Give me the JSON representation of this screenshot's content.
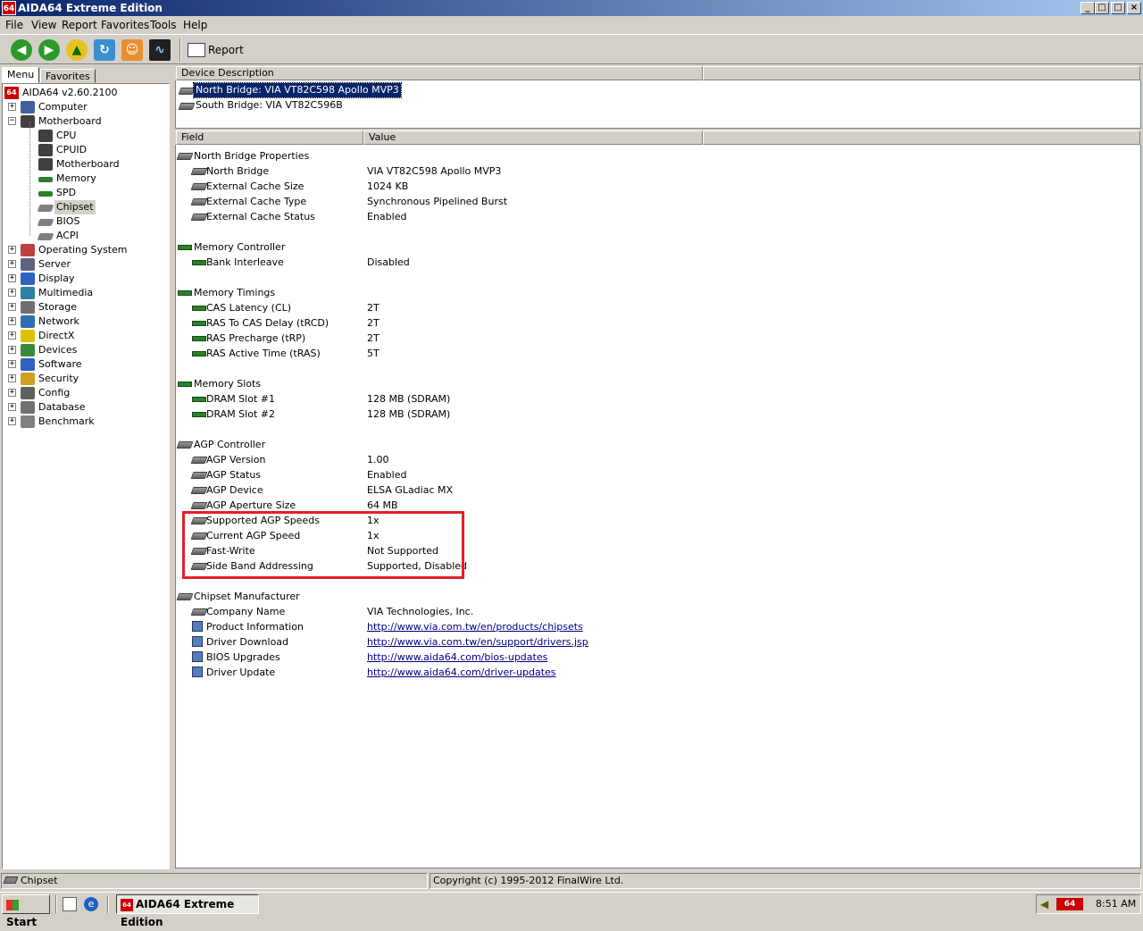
{
  "window": {
    "title": "AIDA64 Extreme Edition",
    "app_icon_text": "64",
    "controls": {
      "minimize": "_",
      "maximize": "□",
      "close": "×"
    }
  },
  "menubar": [
    "File",
    "View",
    "Report",
    "Favorites",
    "Tools",
    "Help"
  ],
  "toolbar": {
    "back_icon": "arrow-left-icon",
    "forward_icon": "arrow-right-icon",
    "up_icon": "up-icon",
    "refresh_icon": "refresh-icon",
    "users_icon": "users-icon",
    "monitor_icon": "monitor-icon",
    "report_label": "Report"
  },
  "left_tabs": [
    "Menu",
    "Favorites"
  ],
  "tree": {
    "root": "AIDA64 v2.60.2100",
    "items": [
      {
        "label": "Computer",
        "level": 1,
        "expander": "+"
      },
      {
        "label": "Motherboard",
        "level": 1,
        "expander": "−"
      },
      {
        "label": "CPU",
        "level": 2
      },
      {
        "label": "CPUID",
        "level": 2
      },
      {
        "label": "Motherboard",
        "level": 2
      },
      {
        "label": "Memory",
        "level": 2
      },
      {
        "label": "SPD",
        "level": 2
      },
      {
        "label": "Chipset",
        "level": 2,
        "selected": true
      },
      {
        "label": "BIOS",
        "level": 2
      },
      {
        "label": "ACPI",
        "level": 2
      },
      {
        "label": "Operating System",
        "level": 1,
        "expander": "+"
      },
      {
        "label": "Server",
        "level": 1,
        "expander": "+"
      },
      {
        "label": "Display",
        "level": 1,
        "expander": "+"
      },
      {
        "label": "Multimedia",
        "level": 1,
        "expander": "+"
      },
      {
        "label": "Storage",
        "level": 1,
        "expander": "+"
      },
      {
        "label": "Network",
        "level": 1,
        "expander": "+"
      },
      {
        "label": "DirectX",
        "level": 1,
        "expander": "+"
      },
      {
        "label": "Devices",
        "level": 1,
        "expander": "+"
      },
      {
        "label": "Software",
        "level": 1,
        "expander": "+"
      },
      {
        "label": "Security",
        "level": 1,
        "expander": "+"
      },
      {
        "label": "Config",
        "level": 1,
        "expander": "+"
      },
      {
        "label": "Database",
        "level": 1,
        "expander": "+"
      },
      {
        "label": "Benchmark",
        "level": 1,
        "expander": "+"
      }
    ]
  },
  "device_panel": {
    "header": "Device Description",
    "items": [
      {
        "label": "North Bridge: VIA VT82C598 Apollo MVP3",
        "selected": true
      },
      {
        "label": "South Bridge: VIA VT82C596B"
      }
    ]
  },
  "field_panel": {
    "headers": [
      "Field",
      "Value"
    ],
    "groups": [
      {
        "title": "North Bridge Properties",
        "icon": "chip",
        "rows": [
          {
            "field": "North Bridge",
            "value": "VIA VT82C598 Apollo MVP3",
            "icon": "chip"
          },
          {
            "field": "External Cache Size",
            "value": "1024 KB",
            "icon": "chip"
          },
          {
            "field": "External Cache Type",
            "value": "Synchronous Pipelined Burst",
            "icon": "chip"
          },
          {
            "field": "External Cache Status",
            "value": "Enabled",
            "icon": "chip"
          }
        ]
      },
      {
        "title": "Memory Controller",
        "icon": "ram",
        "rows": [
          {
            "field": "Bank Interleave",
            "value": "Disabled",
            "icon": "ram"
          }
        ]
      },
      {
        "title": "Memory Timings",
        "icon": "ram",
        "rows": [
          {
            "field": "CAS Latency (CL)",
            "value": "2T",
            "icon": "ram"
          },
          {
            "field": "RAS To CAS Delay (tRCD)",
            "value": "2T",
            "icon": "ram"
          },
          {
            "field": "RAS Precharge (tRP)",
            "value": "2T",
            "icon": "ram"
          },
          {
            "field": "RAS Active Time (tRAS)",
            "value": "5T",
            "icon": "ram"
          }
        ]
      },
      {
        "title": "Memory Slots",
        "icon": "ram",
        "rows": [
          {
            "field": "DRAM Slot #1",
            "value": "128 MB  (SDRAM)",
            "icon": "ram"
          },
          {
            "field": "DRAM Slot #2",
            "value": "128 MB  (SDRAM)",
            "icon": "ram"
          }
        ]
      },
      {
        "title": "AGP Controller",
        "icon": "chip",
        "rows": [
          {
            "field": "AGP Version",
            "value": "1.00",
            "icon": "chip"
          },
          {
            "field": "AGP Status",
            "value": "Enabled",
            "icon": "chip"
          },
          {
            "field": "AGP Device",
            "value": "ELSA GLadiac MX",
            "icon": "chip"
          },
          {
            "field": "AGP Aperture Size",
            "value": "64 MB",
            "icon": "chip"
          },
          {
            "field": "Supported AGP Speeds",
            "value": "1x",
            "icon": "chip"
          },
          {
            "field": "Current AGP Speed",
            "value": "1x",
            "icon": "chip"
          },
          {
            "field": "Fast-Write",
            "value": "Not Supported",
            "icon": "chip"
          },
          {
            "field": "Side Band Addressing",
            "value": "Supported, Disabled",
            "icon": "chip"
          }
        ]
      },
      {
        "title": "Chipset Manufacturer",
        "icon": "chip",
        "rows": [
          {
            "field": "Company Name",
            "value": "VIA Technologies, Inc.",
            "icon": "chip"
          },
          {
            "field": "Product Information",
            "value": "http://www.via.com.tw/en/products/chipsets",
            "icon": "link",
            "link": true
          },
          {
            "field": "Driver Download",
            "value": "http://www.via.com.tw/en/support/drivers.jsp",
            "icon": "link",
            "link": true
          },
          {
            "field": "BIOS Upgrades",
            "value": "http://www.aida64.com/bios-updates",
            "icon": "link",
            "link": true
          },
          {
            "field": "Driver Update",
            "value": "http://www.aida64.com/driver-updates",
            "icon": "link",
            "link": true
          }
        ]
      }
    ]
  },
  "statusbar": {
    "left": "Chipset",
    "right": "Copyright (c) 1995-2012 FinalWire Ltd."
  },
  "taskbar": {
    "start_label": "Start",
    "task_label": "AIDA64 Extreme Edition",
    "tray_app_text": "64",
    "clock": "8:51 AM"
  },
  "colors": {
    "title_gradient_start": "#0a246a",
    "highlight_box": "#e0202a",
    "link": "#000080"
  }
}
